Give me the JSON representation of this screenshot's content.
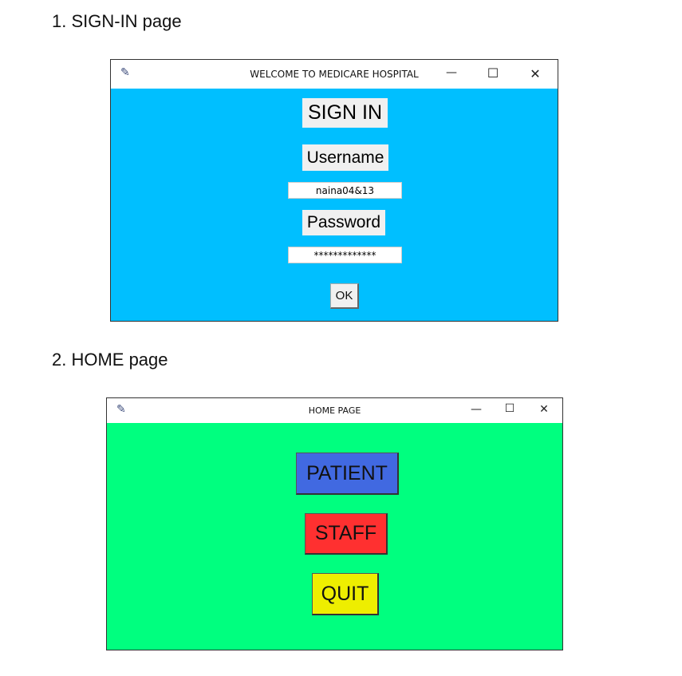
{
  "sections": [
    {
      "heading": "1. SIGN-IN page"
    },
    {
      "heading": "2. HOME page"
    }
  ],
  "signin_window": {
    "title": "WELCOME TO MEDICARE HOSPITAL",
    "bg_color": "#00BFFF",
    "heading": "SIGN IN",
    "username_label": "Username",
    "username_value": "naina04&13",
    "password_label": "Password",
    "password_value": "*************",
    "ok_label": "OK",
    "controls": {
      "minimize": "—",
      "maximize": "☐",
      "close": "✕"
    }
  },
  "home_window": {
    "title": "HOME PAGE",
    "bg_color": "#00FF7F",
    "buttons": [
      {
        "label": "PATIENT",
        "color": "#4169E1"
      },
      {
        "label": "STAFF",
        "color": "#FF3030"
      },
      {
        "label": "QUIT",
        "color": "#EEEE00"
      }
    ],
    "controls": {
      "minimize": "—",
      "maximize": "☐",
      "close": "✕"
    }
  }
}
